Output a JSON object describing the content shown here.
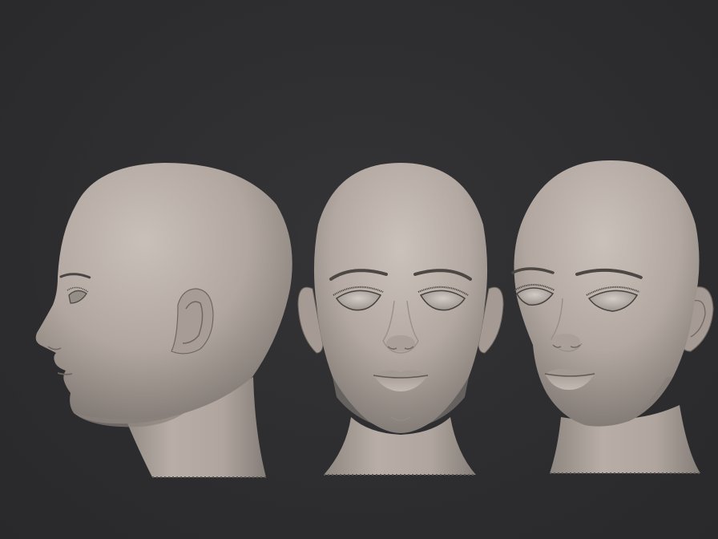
{
  "scene": {
    "background_color": "#2d2d2f",
    "material_color": "#b5aba4",
    "views": [
      {
        "id": "side",
        "orientation": "profile-left"
      },
      {
        "id": "front",
        "orientation": "front"
      },
      {
        "id": "three-quarter",
        "orientation": "three-quarter-right"
      }
    ]
  }
}
